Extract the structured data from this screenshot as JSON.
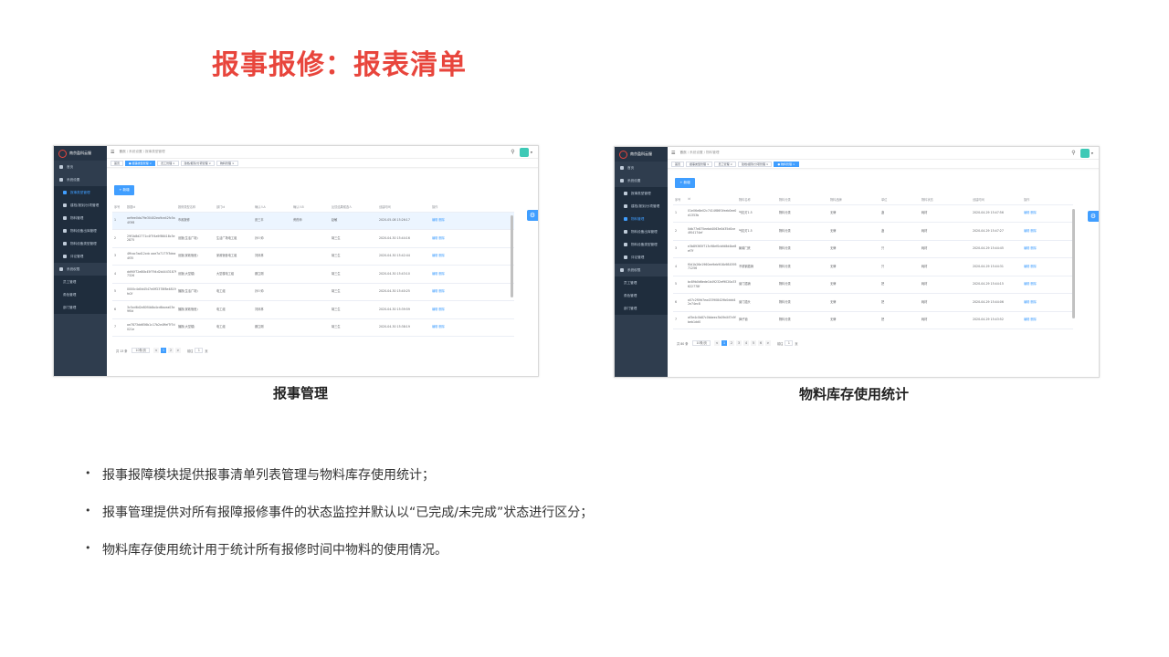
{
  "slide_title": "报事报修：报表清单",
  "captions": {
    "left": "报事管理",
    "right": "物料库存使用统计"
  },
  "bullets": [
    "报事报障模块提供报事清单列表管理与物料库存使用统计；",
    "报事管理提供对所有报障报修事件的状态监控并默认以“已完成/未完成”状态进行区分；",
    "物料库存使用统计用于统计所有报修时间中物料的使用情况。"
  ],
  "app": {
    "brand": "南京盈科云服",
    "hamburger": "☰",
    "search_icon": "⚲",
    "add_button": "+ 新增",
    "settings_icon": "⚙",
    "menu": {
      "home": "首页",
      "system": "系统设置",
      "org": "系统权限",
      "sub_left": [
        "报事类型管理",
        "建档/报到/分项管理",
        "物料管理",
        "物料设备出库管理",
        "物料设备类型管理",
        "评论管理"
      ],
      "sub_left2": [
        "员工管理",
        "角色管理",
        "部门管理"
      ]
    }
  },
  "left_shot": {
    "breadcrumb": "首页",
    "breadcrumb_path": "/ 系统设置 / 报事类型管理",
    "tags": [
      "首页",
      "● 报事类型管理 ×",
      "员工管理 ×",
      "建档/报到/分项管理 ×",
      "物料管理 ×"
    ],
    "columns": [
      "序号",
      "数据id",
      "报修类型名称",
      "部门id",
      "确认人A",
      "确认人B",
      "反馈结果候选人",
      "创建时间",
      "操作"
    ],
    "rows": [
      [
        "1",
        "ae9ee0da79e30402ea9ce42fc5a4f3f8",
        "市政报修",
        "",
        "张三丰",
        "黄药师",
        "赵敏",
        "2020-05-08 15:26:17",
        "编辑 删除"
      ],
      [
        "2",
        "29f1b8d2771c4f7f4a9f86418c3e2875",
        "设施(生活广场)",
        "生活广场电工组",
        "孙少帅",
        "",
        "胡三生",
        "2020-04-30 15:44:16",
        "编辑 删除"
      ],
      [
        "3",
        "4ffcac3ad12cdc aae7a7177f3dea4f35",
        "设施(家政宿舍)",
        "家政宿舍电工组",
        "刘凤林",
        "",
        "胡三生",
        "2020-04-30 15:42:44",
        "编辑 删除"
      ],
      [
        "4",
        "dd90f72e80b45f794d2b4443187f7326",
        "设施(大堂楼)",
        "大堂楼电工组",
        "魏立刚",
        "",
        "胡三生",
        "2020-04-30 15:43:10",
        "编辑 删除"
      ],
      [
        "5",
        "0000c4d0d4547e0ff2378f8e4819fe2f",
        "播报(生活广场)",
        "电工组",
        "孙少帅",
        "",
        "胡三生",
        "2020-04-30 15:40:25",
        "编辑 删除"
      ],
      [
        "6",
        "3c5cd6d2e80f4b8a4cd6acea03e9f0d",
        "播报(家政宿舍)",
        "电工组",
        "刘凤林",
        "",
        "胡三生",
        "2020-04-30 15:39:59",
        "编辑 删除"
      ],
      [
        "7",
        "ae7873dd656b1c17b2e4ffef7f7d021e",
        "播报(大堂楼)",
        "电工组",
        "魏立刚",
        "",
        "胡三生",
        "2020-04-30 15:38:19",
        "编辑 删除"
      ]
    ],
    "pager": {
      "total": "共 13 条",
      "size": "10条/页",
      "pages": [
        "<",
        "1",
        "2",
        ">"
      ],
      "goto": "前往",
      "goto_value": "1",
      "page_unit": "页"
    }
  },
  "right_shot": {
    "breadcrumb": "首页",
    "breadcrumb_path": "/ 系统设置 / 物料管理",
    "tags": [
      "首页",
      "报事类型管理 ×",
      "员工管理 ×",
      "建档/报到/分项管理 ×",
      "● 物料管理 ×"
    ],
    "columns": [
      "序号",
      "id",
      "物料名称",
      "物料分类",
      "物料品牌",
      "单位",
      "物料状态",
      "创建时间",
      "操作"
    ],
    "rows": [
      [
        "1",
        "01e06e8e02c7414f86f1feeb0ee0d1353b",
        "气缸灯1.5",
        "物料分类",
        "无牌",
        "盏",
        "耗材",
        "2020-04-29 15:47:56",
        "编辑 删除"
      ],
      [
        "2",
        "0db77e875eebd4063e0d35d0ce4f04174ef",
        "气缸灯1.5",
        "物料分类",
        "无牌",
        "盏",
        "耗材",
        "2020-04-29 15:47:27",
        "编辑 删除"
      ],
      [
        "3",
        "e3b89365f713c98ef0cbfd8d4be8ef7f",
        "聚碳门夹",
        "物料分类",
        "无牌",
        "只",
        "耗材",
        "2020-04-29 15:44:45",
        "编辑 删除"
      ],
      [
        "4",
        "f0d1b26e1960ee9eb904b98459571256",
        "不锈钢插销",
        "物料分类",
        "无牌",
        "只",
        "耗材",
        "2020-04-29 15:44:31",
        "编辑 删除"
      ],
      [
        "5",
        "bc89b0d6ede1b49232ef9020a33622778f",
        "窗门插销",
        "物料分类",
        "无牌",
        "把",
        "耗材",
        "2020-04-29 15:44:15",
        "编辑 删除"
      ],
      [
        "6",
        "a07c2f0fd7ea433908429b0ddd42e74ec8",
        "窗门插头",
        "物料分类",
        "无牌",
        "把",
        "耗材",
        "2020-04-29 15:44:06",
        "编辑 删除"
      ],
      [
        "7",
        "af3e4c0b87c0bbeec3b09d4f7c9fbeb1dd0",
        "弹子锁",
        "物料分类",
        "无牌",
        "把",
        "耗材",
        "2020-04-29 15:43:52",
        "编辑 删除"
      ]
    ],
    "pager": {
      "total": "共 80 条",
      "size": "10条/页",
      "pages": [
        "<",
        "1",
        "2",
        "3",
        "4",
        "5",
        "6",
        ">"
      ],
      "goto": "前往",
      "goto_value": "1",
      "page_unit": "页"
    }
  },
  "colors": {
    "title": "#e8453c",
    "sidebar": "#2f3d4e",
    "primary": "#409eff",
    "avatar": "#3ec9b6"
  }
}
